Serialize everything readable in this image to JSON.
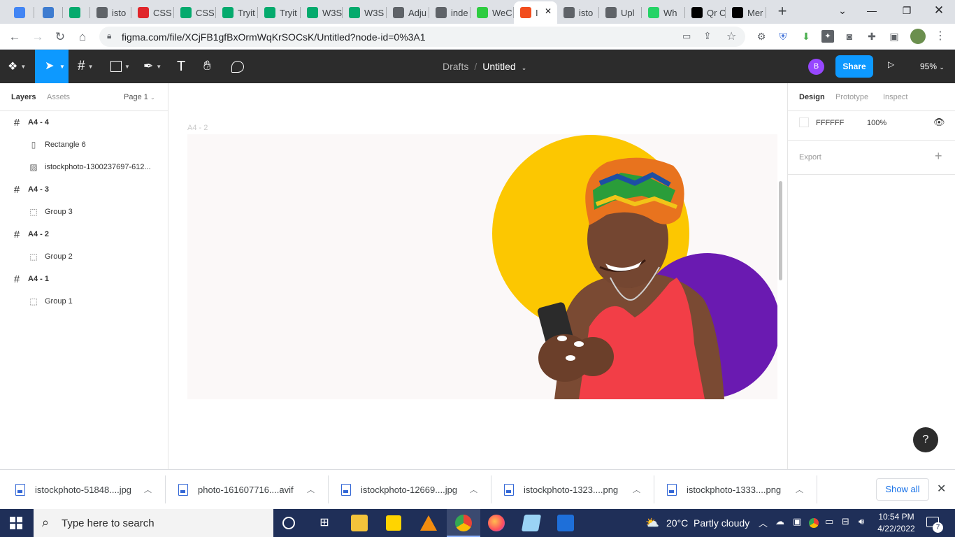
{
  "browser": {
    "tabs": [
      {
        "label": "",
        "favicon": "cloud-icon",
        "color": "#4285f4"
      },
      {
        "label": "",
        "favicon": "ibb-icon",
        "color": "#3e7cd0"
      },
      {
        "label": "",
        "favicon": "w3schools-icon",
        "color": "#04aa6d"
      },
      {
        "label": "isto",
        "favicon": "globe-icon",
        "color": "#5f6368"
      },
      {
        "label": "CSS",
        "favicon": "red-v-icon",
        "color": "#e0262b"
      },
      {
        "label": "CSS",
        "favicon": "w3schools-icon",
        "color": "#04aa6d"
      },
      {
        "label": "Tryit",
        "favicon": "w3schools-icon",
        "color": "#04aa6d"
      },
      {
        "label": "Tryit",
        "favicon": "w3schools-icon",
        "color": "#04aa6d"
      },
      {
        "label": "W3S",
        "favicon": "w3schools-icon",
        "color": "#04aa6d"
      },
      {
        "label": "W3S",
        "favicon": "w3schools-icon",
        "color": "#04aa6d"
      },
      {
        "label": "Adju",
        "favicon": "diamond-icon",
        "color": "#5f6368"
      },
      {
        "label": "inde",
        "favicon": "globe-icon",
        "color": "#5f6368"
      },
      {
        "label": "WeC",
        "favicon": "green-check-icon",
        "color": "#2ecc40"
      },
      {
        "label": "I",
        "favicon": "figma-icon",
        "color": "#f24e1e"
      },
      {
        "label": "isto",
        "favicon": "globe-icon",
        "color": "#5f6368"
      },
      {
        "label": "Upl",
        "favicon": "layers-icon",
        "color": "#5f6368"
      },
      {
        "label": "Wh",
        "favicon": "whatsapp-icon",
        "color": "#25d366"
      },
      {
        "label": "Qr C",
        "favicon": "qr-icon",
        "color": "#000000"
      },
      {
        "label": "Mer",
        "favicon": "s-icon",
        "color": "#000000"
      }
    ],
    "active_tab_index": 13,
    "url": "figma.com/file/XCjFB1gfBxOrmWqKrSOCsK/Untitled?node-id=0%3A1"
  },
  "figma": {
    "toolbar": {
      "breadcrumb_parent": "Drafts",
      "breadcrumb_sep": "/",
      "document_title": "Untitled",
      "avatar_initial": "B",
      "share_label": "Share",
      "zoom_label": "95%"
    },
    "left_panel": {
      "tab_layers": "Layers",
      "tab_assets": "Assets",
      "page_label": "Page 1",
      "layers": [
        {
          "label": "A4 - 4",
          "type": "frame",
          "level": 0
        },
        {
          "label": "Rectangle 6",
          "type": "rectangle",
          "level": 1
        },
        {
          "label": "istockphoto-1300237697-612...",
          "type": "image",
          "level": 1
        },
        {
          "label": "A4 - 3",
          "type": "frame",
          "level": 0
        },
        {
          "label": "Group 3",
          "type": "group",
          "level": 1
        },
        {
          "label": "A4 - 2",
          "type": "frame",
          "level": 0
        },
        {
          "label": "Group 2",
          "type": "group",
          "level": 1
        },
        {
          "label": "A4 - 1",
          "type": "frame",
          "level": 0
        },
        {
          "label": "Group 1",
          "type": "group",
          "level": 1
        }
      ]
    },
    "canvas": {
      "frame_label": "A4 - 2",
      "colors": {
        "yellow_circle": "#fcc701",
        "purple_circle": "#6a1ab1",
        "frame_bg": "#fbf8f8"
      }
    },
    "right_panel": {
      "tab_design": "Design",
      "tab_prototype": "Prototype",
      "tab_inspect": "Inspect",
      "fill_hex": "FFFFFF",
      "fill_opacity": "100%",
      "export_label": "Export"
    },
    "help_label": "?"
  },
  "downloads": {
    "items": [
      {
        "name": "istockphoto-51848....jpg"
      },
      {
        "name": "photo-161607716....avif"
      },
      {
        "name": "istockphoto-12669....jpg"
      },
      {
        "name": "istockphoto-1323....png"
      },
      {
        "name": "istockphoto-1333....png"
      }
    ],
    "show_all": "Show all"
  },
  "taskbar": {
    "search_placeholder": "Type here to search",
    "weather": "20°C  Partly cloudy",
    "time": "10:54 PM",
    "date": "4/22/2022",
    "notification_count": "7"
  }
}
